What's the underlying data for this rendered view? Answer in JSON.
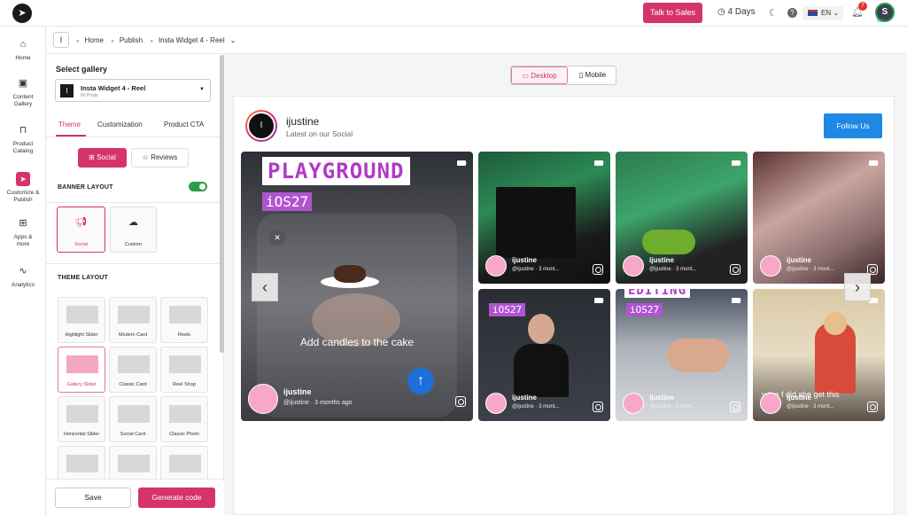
{
  "topbar": {
    "talk_label": "Talk to Sales",
    "days_label": "4 Days",
    "lang": "EN",
    "notif_count": "7",
    "avatar_letter": "S",
    "profile_pct": "50%"
  },
  "nav": {
    "items": [
      {
        "label": "Home",
        "icon": "home-icon"
      },
      {
        "label": "Content Gallery",
        "icon": "image-icon"
      },
      {
        "label": "Product Catalog",
        "icon": "bag-icon"
      },
      {
        "label": "Customize & Publish",
        "icon": "send-icon"
      },
      {
        "label": "Apps & more",
        "icon": "grid-icon"
      },
      {
        "label": "Analytics",
        "icon": "chart-icon"
      }
    ]
  },
  "breadcrumb": {
    "box": "I",
    "home": "Home",
    "publish": "Publish",
    "current": "Insta Widget 4 - Reel"
  },
  "panel": {
    "select_gallery": "Select gallery",
    "gallery_initial": "I",
    "gallery_name": "Insta Widget 4 - Reel",
    "gallery_posts": "60 Posts",
    "tabs": [
      "Theme",
      "Customization",
      "Product CTA"
    ],
    "social_label": "Social",
    "reviews_label": "Reviews",
    "banner_layout": "BANNER LAYOUT",
    "banner_social": "Social",
    "banner_custom": "Custom",
    "theme_layout": "THEME LAYOUT",
    "layouts": [
      "Highlight Slider",
      "Modern Card",
      "Reels",
      "Gallery Slider",
      "Classic Card",
      "Reel Shop",
      "Horizontal Slider",
      "Social Card",
      "Classic Photo"
    ],
    "save_label": "Save",
    "generate_label": "Generate code"
  },
  "device": {
    "desktop": "Desktop",
    "mobile": "Mobile"
  },
  "preview": {
    "avatar_letter": "I",
    "name": "ijustine",
    "subtitle": "Latest on our Social",
    "follow_label": "Follow Us",
    "big_title": "PLAYGROUND",
    "big_tag": "iOS27",
    "caption": "Add candles to the cake",
    "user": "ijustine",
    "handle_big": "@ijustine · 3 months ago",
    "handle_small": "@ijustine · 3 mont...",
    "tag2": "iOS27",
    "tag3": "EDITING",
    "tag3b": "iOS27",
    "tile8_caption": "y the f did she get this"
  },
  "colors": {
    "accent": "#d6336c",
    "follow": "#1e88e5",
    "toggle_on": "#2a9d4b"
  }
}
